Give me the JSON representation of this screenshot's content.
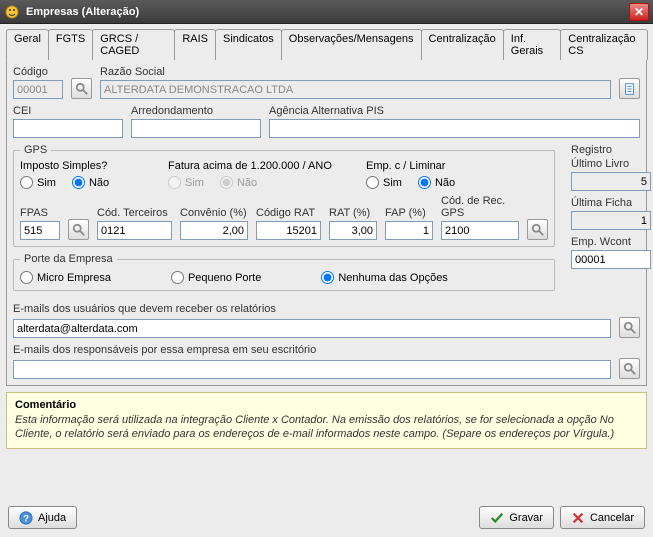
{
  "window": {
    "title": "Empresas (Alteração)"
  },
  "tabs": [
    "Geral",
    "FGTS",
    "GRCS / CAGED",
    "RAIS",
    "Sindicatos",
    "Observações/Mensagens",
    "Centralização",
    "Inf. Gerais",
    "Centralização CS"
  ],
  "activeTab": 0,
  "geral": {
    "codigo": {
      "label": "Código",
      "value": "00001"
    },
    "razao": {
      "label": "Razão Social",
      "value": "ALTERDATA DEMONSTRACAO LTDA"
    },
    "cei": {
      "label": "CEI",
      "value": ""
    },
    "arred": {
      "label": "Arredondamento",
      "value": ""
    },
    "agpis": {
      "label": "Agência Alternativa PIS",
      "value": ""
    },
    "gps": {
      "legend": "GPS",
      "imposto": {
        "label": "Imposto Simples?",
        "sim": "Sim",
        "nao": "Não",
        "value": "nao"
      },
      "fatura": {
        "label": "Fatura acima de 1.200.000 / ANO",
        "sim": "Sim",
        "nao": "Não",
        "value": "nao"
      },
      "liminar": {
        "label": "Emp. c / Liminar",
        "sim": "Sim",
        "nao": "Não",
        "value": "nao"
      },
      "fpas": {
        "label": "FPAS",
        "value": "515"
      },
      "codterc": {
        "label": "Cód. Terceiros",
        "value": "0121"
      },
      "convenio": {
        "label": "Convênio (%)",
        "value": "2,00"
      },
      "codrat": {
        "label": "Código RAT",
        "value": "15201"
      },
      "rat": {
        "label": "RAT (%)",
        "value": "3,00"
      },
      "fap": {
        "label": "FAP (%)",
        "value": "1"
      },
      "codrec": {
        "label": "Cód. de Rec. GPS",
        "value": "2100"
      }
    },
    "stats": {
      "registro": {
        "label1": "Registro",
        "label2": "Último Livro",
        "value": "5"
      },
      "ficha": {
        "label": "Última Ficha",
        "value": "1"
      },
      "wcont": {
        "label": "Emp. Wcont",
        "value": "00001"
      }
    },
    "porte": {
      "legend": "Porte da Empresa",
      "opts": {
        "micro": "Micro Empresa",
        "pequeno": "Pequeno Porte",
        "nenhuma": "Nenhuma das Opções"
      },
      "value": "nenhuma"
    },
    "emails1": {
      "label": "E-mails dos usuários que devem receber os relatórios",
      "value": "alterdata@alterdata.com"
    },
    "emails2": {
      "label": "E-mails dos responsáveis por essa empresa em seu escritório",
      "value": ""
    }
  },
  "comment": {
    "title": "Comentário",
    "text": "Esta informação será utilizada na integração Cliente x Contador.  Na emissão dos relatórios, se for selecionada a opção No Cliente, o relatório será enviado para os endereços de e-mail informados neste campo.  (Separe os endereços por Vírgula.)"
  },
  "buttons": {
    "ajuda": "Ajuda",
    "gravar": "Gravar",
    "cancelar": "Cancelar"
  }
}
